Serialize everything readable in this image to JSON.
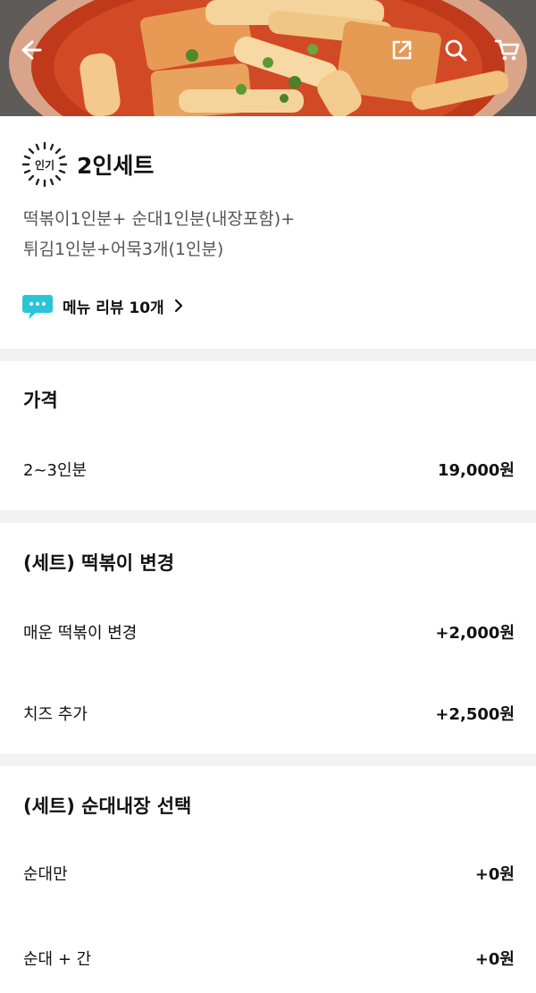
{
  "header": {
    "back_icon": "arrow-left-icon",
    "share_icon": "share-icon",
    "search_icon": "search-icon",
    "cart_icon": "cart-icon"
  },
  "menu": {
    "badge": "인기",
    "title": "2인세트",
    "desc_line1": "떡볶이1인분+ 순대1인분(내장포함)+",
    "desc_line2": "튀김1인분+어묵3개(1인분)",
    "review_icon": "speech-bubble-icon",
    "review_label": "메뉴 리뷰 10개",
    "review_chevron": ">"
  },
  "price_section": {
    "title": "가격",
    "options": [
      {
        "label": "2~3인분",
        "price": "19,000원"
      }
    ]
  },
  "tteok_section": {
    "title": "(세트) 떡볶이 변경",
    "options": [
      {
        "label": "매운 떡볶이 변경",
        "price": "+2,000원"
      },
      {
        "label": "치즈 추가",
        "price": "+2,500원"
      }
    ]
  },
  "sundae_section": {
    "title": "(세트) 순대내장 선택",
    "options": [
      {
        "label": "순대만",
        "price": "+0원"
      },
      {
        "label": "순대 + 간",
        "price": "+0원"
      }
    ]
  },
  "colors": {
    "divider": "#f2f2f2",
    "text_primary": "#111111",
    "text_secondary": "#555555",
    "review_icon": "#29c5d6"
  }
}
